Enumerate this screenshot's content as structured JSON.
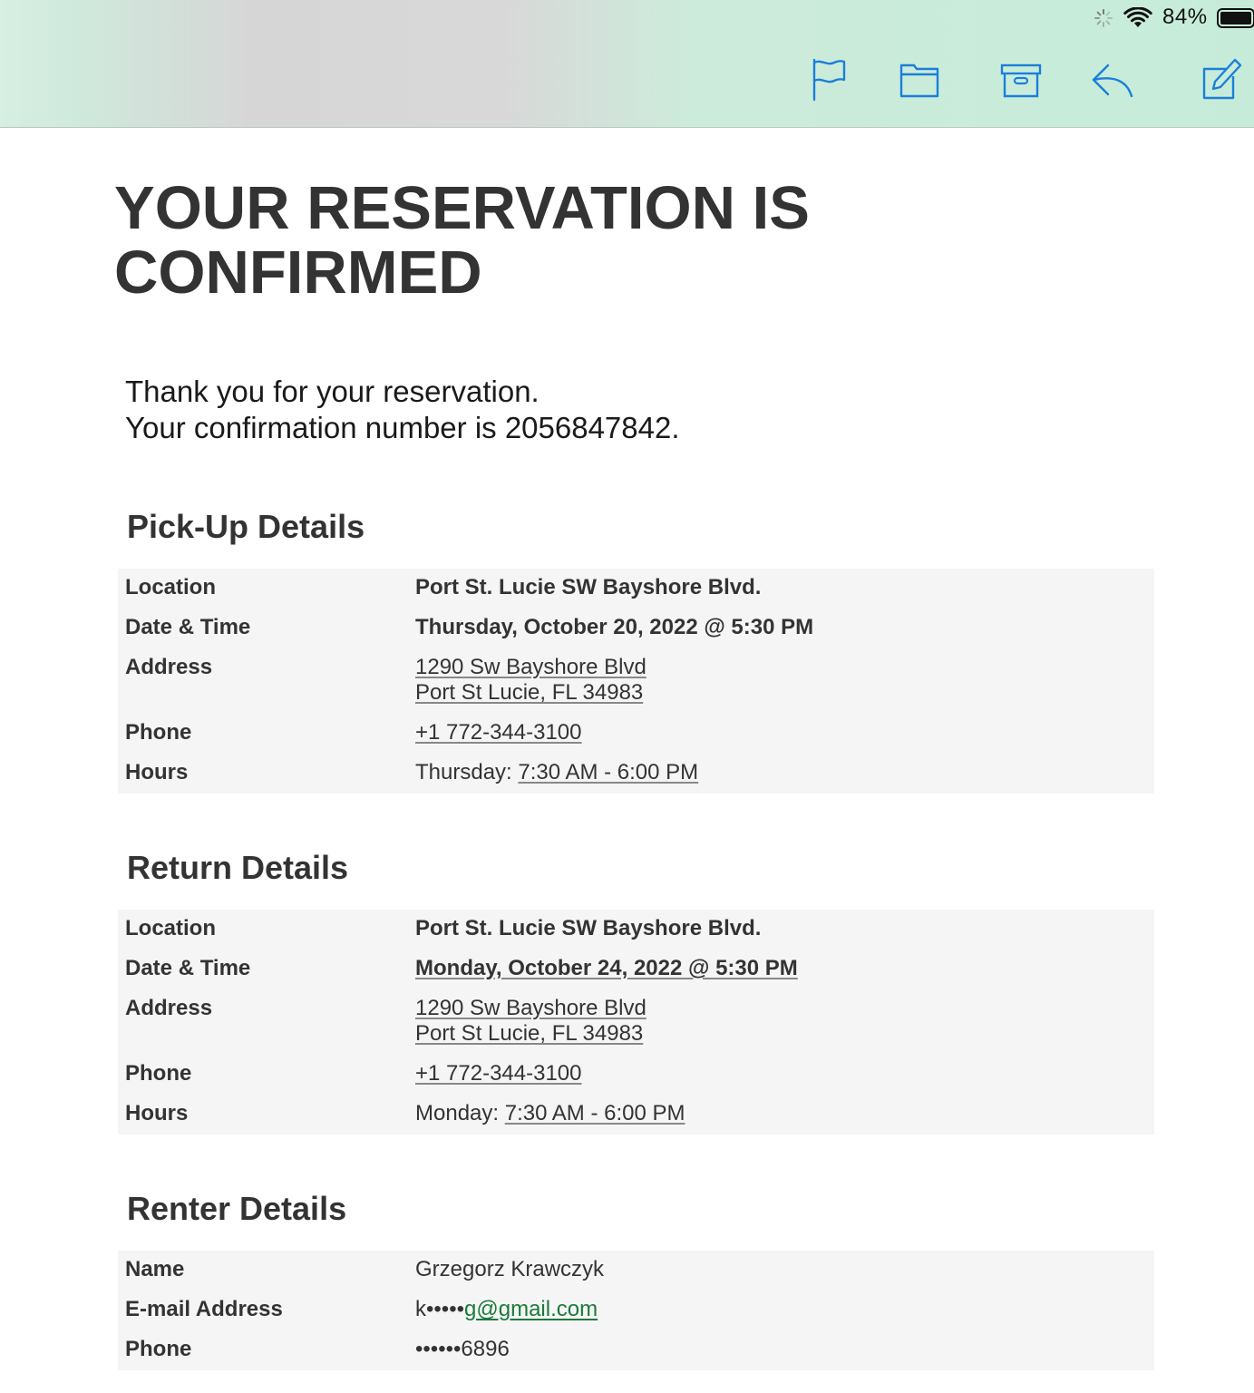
{
  "status_bar": {
    "battery_percent": "84%",
    "icons": [
      "activity-spinner-icon",
      "wifi-icon",
      "battery-icon"
    ]
  },
  "toolbar": {
    "icons": [
      "flag-icon",
      "folder-icon",
      "archive-icon",
      "reply-icon",
      "compose-icon"
    ],
    "accent_color": "#1a7fd9"
  },
  "email": {
    "headline": "YOUR RESERVATION IS CONFIRMED",
    "thanks_line": "Thank you for your reservation.",
    "confirmation_line": "Your confirmation number is 2056847842.",
    "pickup": {
      "title": "Pick-Up Details",
      "location_label": "Location",
      "location": "Port St. Lucie SW Bayshore Blvd.",
      "datetime_label": "Date & Time",
      "datetime": "Thursday, October 20, 2022 @ 5:30 PM",
      "address_label": "Address",
      "address_line1": "1290 Sw Bayshore Blvd",
      "address_line2": "Port St Lucie, FL 34983",
      "phone_label": "Phone",
      "phone": "+1 772-344-3100",
      "hours_label": "Hours",
      "hours_day": "Thursday: ",
      "hours_time": "7:30 AM - 6:00 PM"
    },
    "return": {
      "title": "Return Details",
      "location_label": "Location",
      "location": "Port St. Lucie SW Bayshore Blvd.",
      "datetime_label": "Date & Time",
      "datetime": "Monday, October 24, 2022 @ 5:30 PM",
      "address_label": "Address",
      "address_line1": "1290 Sw Bayshore Blvd",
      "address_line2": "Port St Lucie, FL 34983",
      "phone_label": "Phone",
      "phone": "+1 772-344-3100",
      "hours_label": "Hours",
      "hours_day": "Monday: ",
      "hours_time": "7:30 AM - 6:00 PM"
    },
    "renter": {
      "title": "Renter Details",
      "name_label": "Name",
      "name": "Grzegorz Krawczyk",
      "email_label": "E-mail Address",
      "email_prefix": "k•••••",
      "email_link": "g@gmail.com",
      "phone_label": "Phone",
      "phone": "••••••6896"
    }
  }
}
